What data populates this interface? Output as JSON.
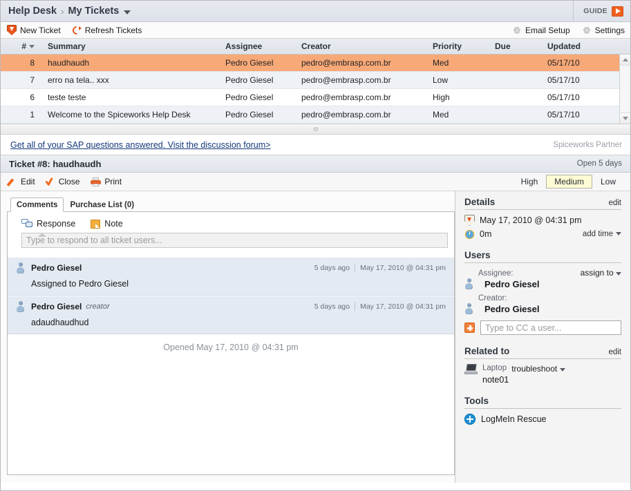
{
  "header": {
    "breadcrumb_root": "Help Desk",
    "breadcrumb_sep": "›",
    "breadcrumb_current": "My Tickets",
    "guide_label": "GUIDE"
  },
  "toolbar": {
    "new_ticket": "New Ticket",
    "refresh_tickets": "Refresh Tickets",
    "email_setup": "Email Setup",
    "settings": "Settings"
  },
  "ticket_list": {
    "columns": [
      "#",
      "Summary",
      "Assignee",
      "Creator",
      "Priority",
      "Due",
      "Updated"
    ],
    "rows": [
      {
        "num": "8",
        "summary": "haudhaudh",
        "assignee": "Pedro Giesel",
        "creator": "pedro@embrasp.com.br",
        "priority": "Med",
        "due": "",
        "updated": "05/17/10"
      },
      {
        "num": "7",
        "summary": "erro na tela.. xxx",
        "assignee": "Pedro Giesel",
        "creator": "pedro@embrasp.com.br",
        "priority": "Low",
        "due": "",
        "updated": "05/17/10"
      },
      {
        "num": "6",
        "summary": "teste teste",
        "assignee": "Pedro Giesel",
        "creator": "pedro@embrasp.com.br",
        "priority": "High",
        "due": "",
        "updated": "05/17/10"
      },
      {
        "num": "1",
        "summary": "Welcome to the Spiceworks Help Desk",
        "assignee": "Pedro Giesel",
        "creator": "pedro@embrasp.com.br",
        "priority": "Med",
        "due": "",
        "updated": "05/17/10"
      }
    ]
  },
  "ad": {
    "link_text": "Get all of your SAP questions answered. Visit the discussion forum>",
    "partner_text": "Spiceworks Partner"
  },
  "ticket": {
    "title": "Ticket #8: haudhaudh",
    "open_status": "Open 5 days",
    "edit": "Edit",
    "close": "Close",
    "print": "Print",
    "priority_high": "High",
    "priority_medium": "Medium",
    "priority_low": "Low",
    "priority_selected": "Medium"
  },
  "tabs": [
    {
      "label": "Comments",
      "active": true
    },
    {
      "label": "Purchase List (0)",
      "active": false
    }
  ],
  "compose": {
    "response_label": "Response",
    "note_label": "Note",
    "placeholder": "Type to respond to all ticket users..."
  },
  "comments": [
    {
      "author": "Pedro Giesel",
      "role": "",
      "ago": "5 days ago",
      "date": "May 17, 2010 @ 04:31 pm",
      "body": "Assigned to Pedro Giesel"
    },
    {
      "author": "Pedro Giesel",
      "role": "creator",
      "ago": "5 days ago",
      "date": "May 17, 2010 @ 04:31 pm",
      "body": "adaudhaudhud"
    }
  ],
  "opened_line": "Opened May 17, 2010 @ 04:31 pm",
  "sidebar": {
    "details": {
      "title": "Details",
      "edit": "edit",
      "created_date": "May 17, 2010 @ 04:31 pm",
      "time_spent": "0m",
      "add_time": "add time"
    },
    "users": {
      "title": "Users",
      "assignee_label": "Assignee:",
      "assign_to": "assign to",
      "assignee_name": "Pedro Giesel",
      "creator_label": "Creator:",
      "creator_name": "Pedro Giesel",
      "cc_placeholder": "Type to CC a user..."
    },
    "related": {
      "title": "Related to",
      "edit": "edit",
      "device_kind": "Laptop",
      "device_name": "note01",
      "troubleshoot": "troubleshoot"
    },
    "tools": {
      "title": "Tools",
      "items": [
        "LogMeIn Rescue"
      ]
    }
  },
  "colors": {
    "accent_orange": "#e8561e",
    "selected_row": "#f7a978",
    "highlight_yellow": "#fdfbd4",
    "link_blue": "#14387b",
    "sidebar_bg": "#f4f4f4"
  }
}
